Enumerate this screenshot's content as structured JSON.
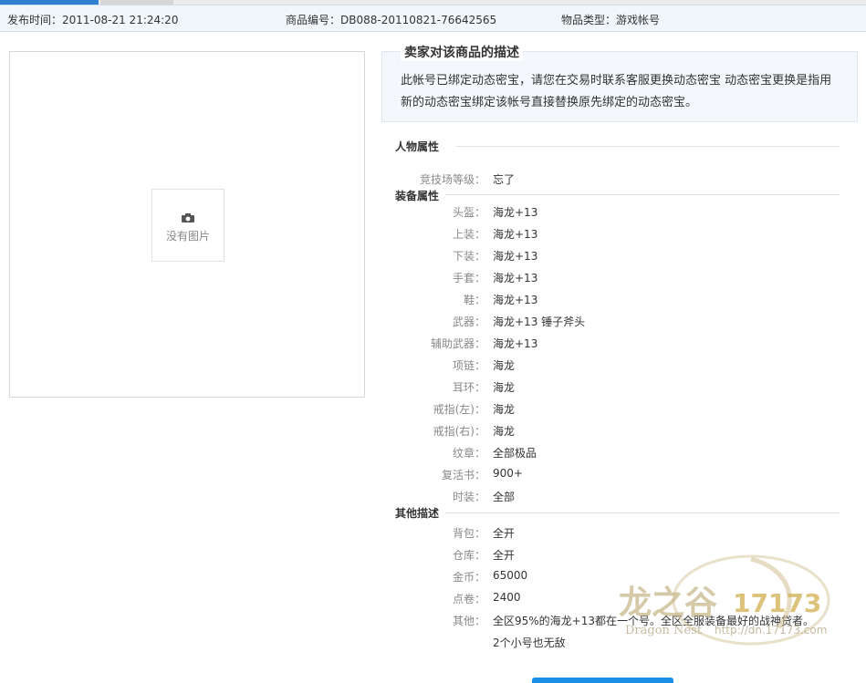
{
  "info_bar": {
    "publish_time": "发布时间：2011-08-21 21:24:20",
    "item_id": "商品编号：DB088-20110821-76642565",
    "item_type": "物品类型：游戏帐号"
  },
  "photo": {
    "placeholder_text": "没有图片"
  },
  "seller_description": {
    "title": "卖家对该商品的描述",
    "text": "此帐号已绑定动态密宝，请您在交易时联系客服更换动态密宝 动态密宝更换是指用新的动态密宝绑定该帐号直接替换原先绑定的动态密宝。"
  },
  "sections": {
    "character": {
      "title": "人物属性",
      "rows": [
        {
          "label": "竞技场等级：",
          "value": "忘了"
        }
      ]
    },
    "equipment": {
      "title": "装备属性",
      "rows": [
        {
          "label": "头盔：",
          "value": "海龙+13"
        },
        {
          "label": "上装：",
          "value": "海龙+13"
        },
        {
          "label": "下装：",
          "value": "海龙+13"
        },
        {
          "label": "手套：",
          "value": "海龙+13"
        },
        {
          "label": "鞋：",
          "value": "海龙+13"
        },
        {
          "label": "武器：",
          "value": "海龙+13 锤子斧头"
        },
        {
          "label": "辅助武器：",
          "value": "海龙+13"
        },
        {
          "label": "项链：",
          "value": "海龙"
        },
        {
          "label": "耳环：",
          "value": "海龙"
        },
        {
          "label": "戒指(左)：",
          "value": "海龙"
        },
        {
          "label": "戒指(右)：",
          "value": "海龙"
        },
        {
          "label": "纹章：",
          "value": "全部极品"
        },
        {
          "label": "复活书：",
          "value": "900+"
        },
        {
          "label": "时装：",
          "value": "全部"
        }
      ]
    },
    "other": {
      "title": "其他描述",
      "rows": [
        {
          "label": "背包：",
          "value": "全开"
        },
        {
          "label": "仓库：",
          "value": "全开"
        },
        {
          "label": "金币：",
          "value": "65000"
        },
        {
          "label": "点卷：",
          "value": "2400"
        },
        {
          "label": "其他：",
          "value": "全区95%的海龙+13都在一个号。全区全服装备最好的战神贷者。"
        }
      ],
      "extra_line": "2个小号也无敌"
    }
  },
  "watermark": {
    "logo_text": "龙之谷",
    "site_number": "17173",
    "subtitle": "Dragon Nest",
    "url": "http://dn.17173.com"
  }
}
